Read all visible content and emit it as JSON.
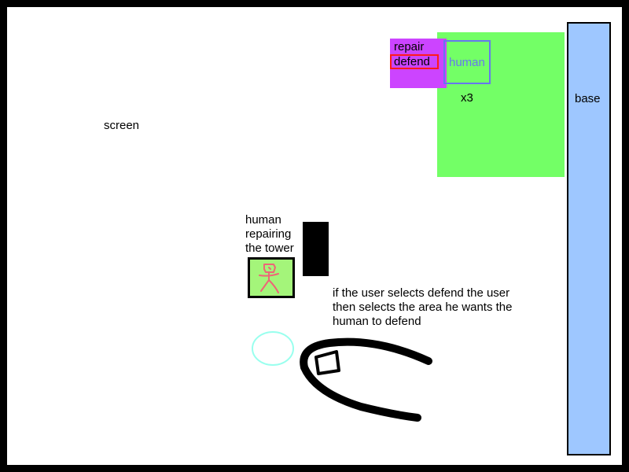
{
  "labels": {
    "screen": "screen",
    "repair": "repair",
    "defend": "defend",
    "human": "human",
    "count": "x3",
    "base": "base",
    "repair_caption": "human repairing the tower",
    "defend_caption": "if the user selects defend the user then selects the area he wants the human to defend"
  },
  "colors": {
    "background": "#ffffff",
    "frame": "#000000",
    "green_panel": "#73ff66",
    "action_menu": "#cc44ff",
    "defend_highlight": "#ff1a1a",
    "human_box": "#6677ee",
    "base": "#9ec7ff",
    "human_sprite_bg": "#a4f57a",
    "human_figure": "#ee6677",
    "target_circle": "#99ffee"
  },
  "icons": {
    "human_figure": "stick-figure-icon",
    "mouse_cursor": "hand-pointer-sketch",
    "target_area": "circle-outline"
  }
}
